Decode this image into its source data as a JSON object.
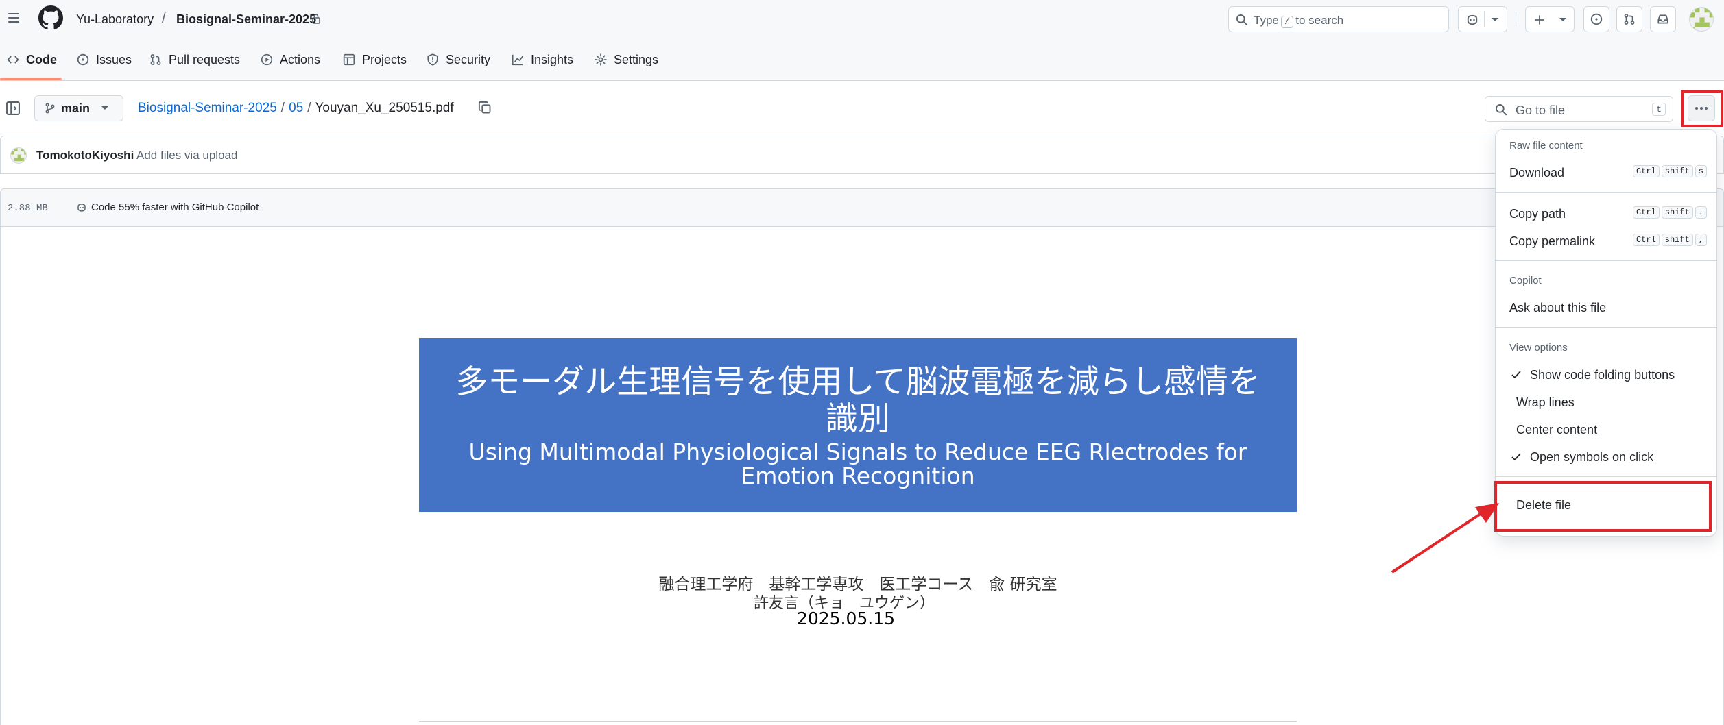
{
  "header": {
    "owner": "Yu-Laboratory",
    "separator": "/",
    "repo": "Biosignal-Seminar-2025",
    "search": {
      "prefix": "Type",
      "key": "/",
      "suffix": "to search"
    }
  },
  "repo_nav": {
    "tabs": [
      {
        "label": "Code",
        "icon": "code-icon",
        "active": true
      },
      {
        "label": "Issues",
        "icon": "issue-icon"
      },
      {
        "label": "Pull requests",
        "icon": "pull-request-icon"
      },
      {
        "label": "Actions",
        "icon": "play-icon"
      },
      {
        "label": "Projects",
        "icon": "table-icon"
      },
      {
        "label": "Security",
        "icon": "shield-icon"
      },
      {
        "label": "Insights",
        "icon": "graph-icon"
      },
      {
        "label": "Settings",
        "icon": "gear-icon"
      }
    ]
  },
  "file_header": {
    "branch": "main",
    "path_repo": "Biosignal-Seminar-2025",
    "path_dir": "05",
    "path_sep": "/",
    "file_name": "Youyan_Xu_250515.pdf",
    "goto_placeholder": "Go to file",
    "goto_key": "t"
  },
  "commit": {
    "author": "TomokotoKiyoshi",
    "message": "Add files via upload"
  },
  "file_info": {
    "size": "2.88 MB",
    "copilot_promo": "Code 55% faster with GitHub Copilot"
  },
  "slide": {
    "title_jp": "多モーダル生理信号を使用して脳波電極を減らし感情を識別",
    "title_en": "Using Multimodal Physiological Signals to Reduce EEG Rlectrodes for Emotion Recognition",
    "affiliation": "融合理工学府　基幹工学専攻　医工学コース　兪 研究室",
    "author": "許友言（キョ　ユウゲン）",
    "date": "2025.05.15"
  },
  "menu": {
    "raw_label": "Raw file content",
    "download": {
      "label": "Download",
      "keys": [
        "Ctrl",
        "shift",
        "s"
      ]
    },
    "copy_path": {
      "label": "Copy path",
      "keys": [
        "Ctrl",
        "shift",
        "."
      ]
    },
    "copy_permalink": {
      "label": "Copy permalink",
      "keys": [
        "Ctrl",
        "shift",
        ","
      ]
    },
    "copilot_label": "Copilot",
    "ask": "Ask about this file",
    "view_label": "View options",
    "show_folding": "Show code folding buttons",
    "wrap_lines": "Wrap lines",
    "center_content": "Center content",
    "open_symbols": "Open symbols on click",
    "delete": "Delete file"
  },
  "colors": {
    "accent_link": "#0969da",
    "highlight": "#e0252b",
    "slide_blue": "#4472c4",
    "tab_underline": "#fd8c73"
  }
}
